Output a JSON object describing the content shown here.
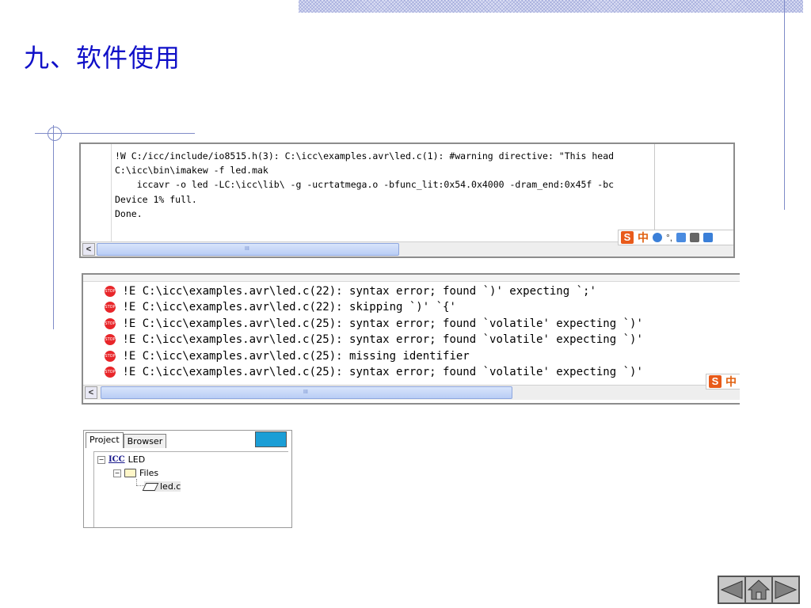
{
  "slide_title": "九、软件使用",
  "build_output": {
    "lines": [
      "!W C:/icc/include/io8515.h(3): C:\\icc\\examples.avr\\led.c(1): #warning directive: \"This head",
      "C:\\icc\\bin\\imakew -f led.mak",
      "    iccavr -o led -LC:\\icc\\lib\\ -g -ucrtatmega.o -bfunc_lit:0x54.0x4000 -dram_end:0x45f -bc",
      "Device 1% full.",
      "Done."
    ],
    "scroll_thumb_mark": "III"
  },
  "error_output": {
    "lines": [
      "!E C:\\icc\\examples.avr\\led.c(22): syntax error; found `)' expecting `;'",
      "!E C:\\icc\\examples.avr\\led.c(22): skipping `)' `{'",
      "!E C:\\icc\\examples.avr\\led.c(25): syntax error; found `volatile' expecting `)'",
      "!E C:\\icc\\examples.avr\\led.c(25): syntax error; found `volatile' expecting `)'",
      "!E C:\\icc\\examples.avr\\led.c(25): missing identifier",
      "!E C:\\icc\\examples.avr\\led.c(25): syntax error; found `volatile' expecting `)'"
    ],
    "stop_icon_text": "STOP",
    "scroll_thumb_mark": "III"
  },
  "ime_toolbar": {
    "s_label": "S",
    "zh_label": "中",
    "punct": "°,"
  },
  "project_panel": {
    "tabs": [
      "Project",
      "Browser"
    ],
    "tree": {
      "root_label": "LED",
      "root_icon_text": "ICC",
      "folder_label": "Files",
      "file_label": "led.c"
    }
  },
  "nav": {
    "buttons": [
      "previous",
      "home",
      "next"
    ]
  },
  "colors": {
    "title": "#1010c8",
    "accent_line": "#7f8bc8",
    "stop_red": "#e8262a",
    "ime_orange": "#e85a1a"
  }
}
